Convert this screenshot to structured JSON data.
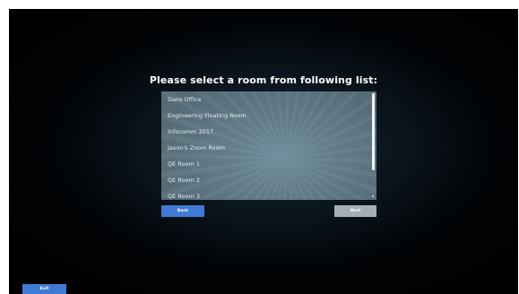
{
  "prompt": {
    "heading": "Please select a room from following list:"
  },
  "rooms": [
    "Dans Office",
    "Engineering Floating Room",
    "Infocomm 2017",
    "Jason's Zoom Room",
    "QE Room 1",
    "QE Room 2",
    "QE Room 3"
  ],
  "buttons": {
    "back": "Back",
    "next": "Next",
    "exit": "Exit"
  },
  "colors": {
    "primary_button": "#3e7bd6",
    "disabled_button": "#a4aeb4",
    "list_background": "#5d7481",
    "backdrop": "#000000"
  },
  "state": {
    "next_enabled": false
  }
}
